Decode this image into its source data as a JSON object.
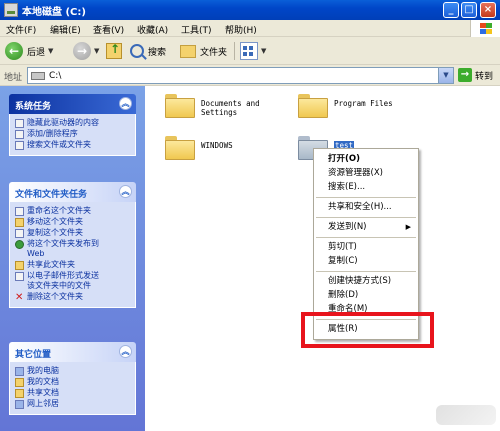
{
  "window": {
    "title": "本地磁盘 (C:)"
  },
  "menu": {
    "items": [
      "文件(F)",
      "编辑(E)",
      "查看(V)",
      "收藏(A)",
      "工具(T)",
      "帮助(H)"
    ]
  },
  "toolbar": {
    "back_label": "后退",
    "search_label": "搜索",
    "folders_label": "文件夹"
  },
  "address": {
    "label": "地址",
    "value": "C:\\",
    "go_label": "转到"
  },
  "taskpane": {
    "system_tasks": {
      "title": "系统任务",
      "items": [
        "隐藏此驱动器的内容",
        "添加/删除程序",
        "搜索文件或文件夹"
      ]
    },
    "file_tasks": {
      "title": "文件和文件夹任务",
      "items": [
        "重命名这个文件夹",
        "移动这个文件夹",
        "复制这个文件夹",
        "将这个文件夹发布到",
        "Web",
        "共享此文件夹",
        "以电子邮件形式发送",
        "该文件夹中的文件",
        "删除这个文件夹"
      ]
    },
    "other_places": {
      "title": "其它位置",
      "items": [
        "我的电脑",
        "我的文档",
        "共享文档",
        "网上邻居"
      ]
    }
  },
  "files": [
    {
      "name_line1": "Documents and",
      "name_line2": "Settings",
      "icon": "folder-icon"
    },
    {
      "name_line1": "Program Files",
      "name_line2": "",
      "icon": "folder-icon"
    },
    {
      "name_line1": "WINDOWS",
      "name_line2": "",
      "icon": "folder-icon"
    },
    {
      "name_line1": "test",
      "name_line2": "",
      "icon": "shared-folder-icon",
      "selected": true
    }
  ],
  "context_menu": {
    "items": [
      "打开(O)",
      "资源管理器(X)",
      "搜索(E)...",
      "共享和安全(H)...",
      "发送到(N)",
      "剪切(T)",
      "复制(C)",
      "创建快捷方式(S)",
      "删除(D)",
      "重命名(M)",
      "属性(R)"
    ]
  },
  "colors": {
    "highlight": "#e8141c",
    "titlebar": "#0046c8",
    "selection": "#316ac5"
  }
}
